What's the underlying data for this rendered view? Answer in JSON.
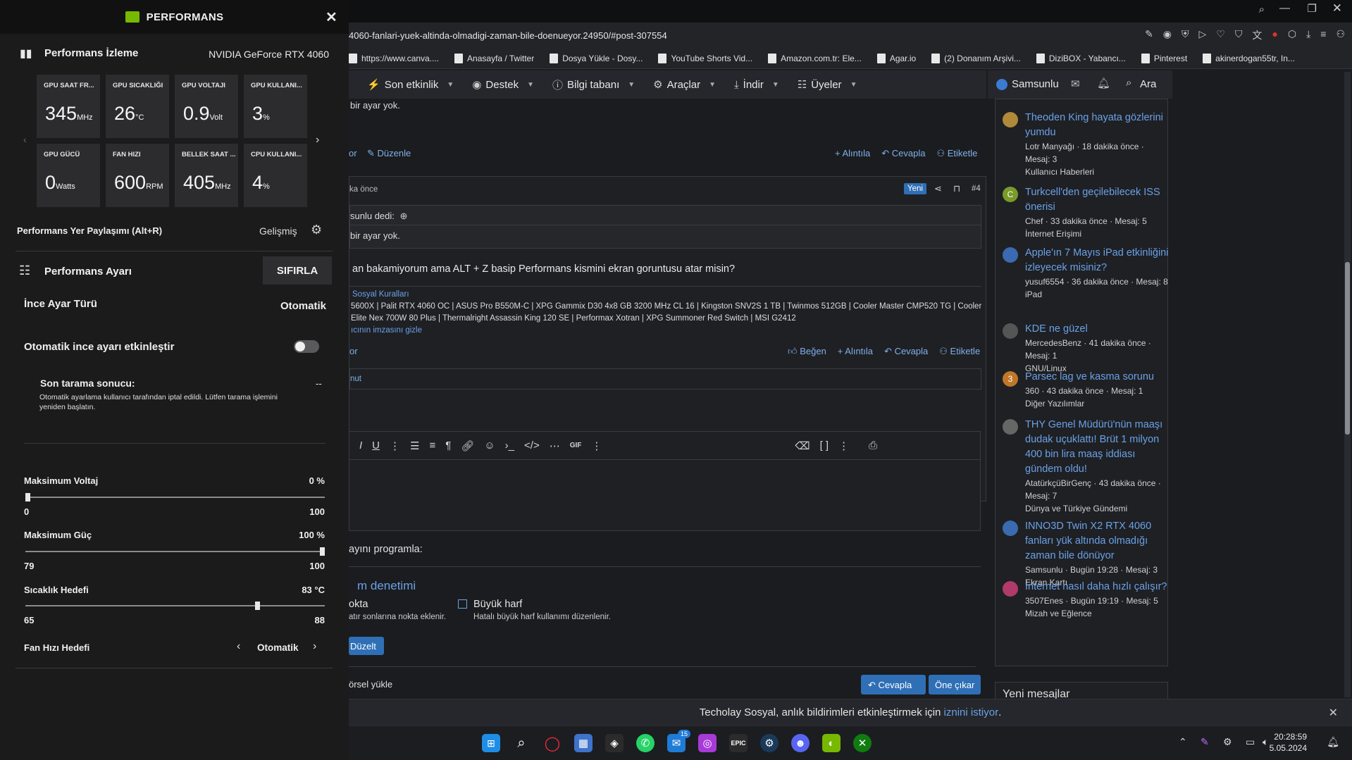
{
  "browser": {
    "url": "4060-fanlari-yuek-altinda-olmadigi-zaman-bile-doenueyor.24950/#post-307554",
    "bookmarks": [
      "https://www.canva....",
      "Anasayfa / Twitter",
      "Dosya Yükle - Dosy...",
      "YouTube Shorts Vid...",
      "Amazon.com.tr: Ele...",
      "Agar.io",
      "(2) Donanım Arşivi...",
      "DiziBOX - Yabancı...",
      "Pinterest",
      "akinerdogan55tr, In..."
    ]
  },
  "forum": {
    "nav": [
      "Son etkinlik",
      "Destek",
      "Bilgi tabanı",
      "Araçlar",
      "İndir",
      "Üyeler"
    ],
    "user": "Samsunlu",
    "search": "Ara",
    "post_top_text": "bir ayar yok.",
    "edit_label": "Düzenle",
    "quote_label": "Alıntıla",
    "reply_label": "Cevapla",
    "tag_label": "Etiketle",
    "like_label": "Beğen",
    "post_time": "ka önce",
    "new_badge": "Yeni",
    "post_number": "#4",
    "quote_author": "sunlu dedi:",
    "quote_text": "bir ayar yok.",
    "post_body": "an bakamiyorum ama ALT + Z basip Performans kismini ekran goruntusu atar misin?",
    "sig_rules": "Sosyal Kuralları",
    "signature": "5600X | Palit RTX 4060 OC | ASUS Pro B550M-C | XPG Gammix D30 4x8 GB 3200 MHz CL 16 | Kingston SNV2S 1 TB | Twinmos 512GB | Cooler Master CMP520 TG | Cooler",
    "signature2": "Elite Nex 700W 80 Plus | Thermalright Assassin King 120 SE | Performax Xotran | XPG Summoner Red Switch | MSI G2412",
    "hide_sig": "ıcının imzasını gizle",
    "report": "or",
    "reply_box": "nut",
    "program_label": "ayını programla:",
    "spell_title": "m denetimi",
    "opt1_title": "okta",
    "opt1_desc": "atır sonlarına nokta eklenir.",
    "opt2_title": "Büyük harf",
    "opt2_desc": "Hatalı büyük harf kullanımı düzenlenir.",
    "fix_button": "Düzelt",
    "upload_label": "örsel yükle",
    "submit_reply": "Cevapla",
    "preview": "Öne çıkar",
    "notif": "Techolay Sosyal, anlık bildirimleri etkinleştirmek için",
    "notif_link": "iznini istiyor",
    "notif_dot": ".",
    "new_messages": "Yeni mesajlar",
    "sidebar": [
      {
        "title": "Theoden King hayata gözlerini yumdu",
        "meta": "Lotr Manyağı · 18 dakika önce · Mesaj: 3",
        "cat": "Kullanıcı Haberleri"
      },
      {
        "title": "Turkcell'den geçilebilecek ISS önerisi",
        "meta": "Chef · 33 dakika önce · Mesaj: 5",
        "cat": "İnternet Erişimi"
      },
      {
        "title": "Apple'ın 7 Mayıs iPad etkinliğini izleyecek misiniz?",
        "meta": "yusuf6554 · 36 dakika önce · Mesaj: 8",
        "cat": "iPad"
      },
      {
        "title": "KDE ne güzel",
        "meta": "MercedesBenz · 41 dakika önce · Mesaj: 1",
        "cat": "GNU/Linux"
      },
      {
        "title": "Parsec lag ve kasma sorunu",
        "meta": "360 · 43 dakika önce · Mesaj: 1",
        "cat": "Diğer Yazılımlar"
      },
      {
        "title": "THY Genel Müdürü'nün maaşı dudak uçuklattı! Brüt 1 milyon 400 bin lira maaş iddiası gündem oldu!",
        "meta": "AtatürkçüBirGenç · 43 dakika önce · Mesaj: 7",
        "cat": "Dünya ve Türkiye Gündemi"
      },
      {
        "title": "INNO3D Twin X2 RTX 4060 fanları yük altında olmadığı zaman bile dönüyor",
        "meta": "Samsunlu · Bugün 19:28 · Mesaj: 3",
        "cat": "Ekran Kartı"
      },
      {
        "title": "İnternet nasıl daha hızlı çalışır?",
        "meta": "3507Enes · Bugün 19:19 · Mesaj: 5",
        "cat": "Mizah ve Eğlence"
      }
    ],
    "sidebar_avatars": [
      "",
      "C",
      "",
      "",
      "3",
      "",
      "",
      ""
    ]
  },
  "overlay": {
    "title": "PERFORMANS",
    "monitor_title": "Performans İzleme",
    "gpu_name": "NVIDIA GeForce RTX 4060",
    "tiles": [
      {
        "label": "GPU SAAT FR...",
        "value": "345",
        "unit": "MHz"
      },
      {
        "label": "GPU SICAKLIĞI",
        "value": "26",
        "unit": "°C"
      },
      {
        "label": "GPU VOLTAJI",
        "value": "0.9",
        "unit": "Volt"
      },
      {
        "label": "GPU KULLANI...",
        "value": "3",
        "unit": "%"
      },
      {
        "label": "GPU GÜCÜ",
        "value": "0",
        "unit": "Watts"
      },
      {
        "label": "FAN HIZI",
        "value": "600",
        "unit": "RPM"
      },
      {
        "label": "BELLEK SAAT ...",
        "value": "405",
        "unit": "MHz"
      },
      {
        "label": "CPU KULLANI...",
        "value": "4",
        "unit": "%"
      }
    ],
    "share_label": "Performans Yer Paylaşımı (Alt+R)",
    "advanced": "Gelişmiş",
    "tuning_title": "Performans Ayarı",
    "reset": "SIFIRLA",
    "tune_type_label": "İnce Ayar Türü",
    "tune_type_value": "Otomatik",
    "auto_tune_label": "Otomatik ince ayarı etkinleştir",
    "scan_title": "Son tarama sonucu:",
    "scan_value": "--",
    "scan_desc1": "Otomatik ayarlama kullanıcı tarafından iptal edildi. Lütfen tarama işlemini",
    "scan_desc2": "yeniden başlatın.",
    "voltage_label": "Maksimum Voltaj",
    "voltage_value": "0 %",
    "voltage_min": "0",
    "voltage_max": "100",
    "voltage_level": 0,
    "power_label": "Maksimum Güç",
    "power_value": "100 %",
    "power_min": "79",
    "power_max": "100",
    "power_level": 1.0,
    "temp_label": "Sıcaklık Hedefi",
    "temp_value": "83 °C",
    "temp_min": "65",
    "temp_max": "88",
    "temp_level": 0.78,
    "fan_label": "Fan Hızı Hedefi",
    "fan_value": "Otomatik"
  },
  "taskbar": {
    "time": "20:28:59",
    "date": "5.05.2024",
    "mail_badge": "15"
  },
  "colors": {
    "accent_green": "#76b900",
    "link_blue": "#6aa1e6",
    "button_blue": "#2f6fb6"
  }
}
